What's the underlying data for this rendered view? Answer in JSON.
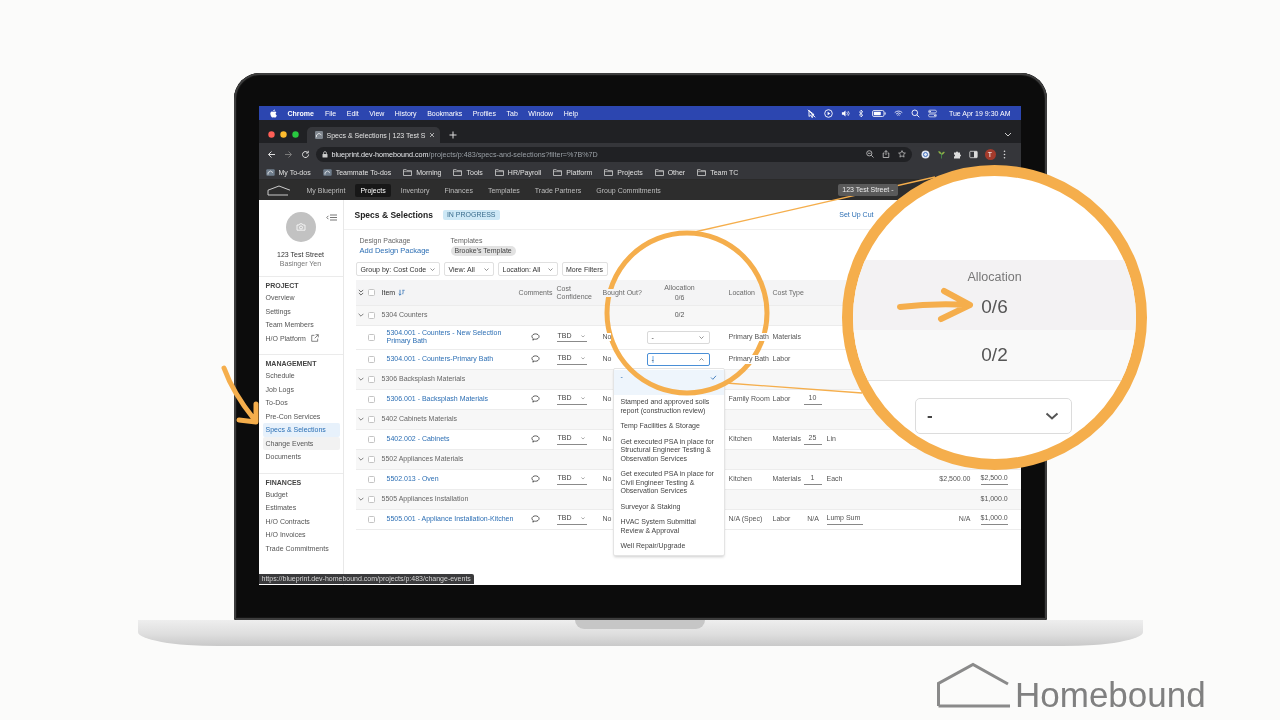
{
  "menu_bar": {
    "app_name": "Chrome",
    "menus": [
      "File",
      "Edit",
      "View",
      "History",
      "Bookmarks",
      "Profiles",
      "Tab",
      "Window",
      "Help"
    ],
    "clock": "Tue Apr 19 9:30 AM"
  },
  "browser": {
    "tab_title": "Specs & Selections | 123 Test S",
    "url_host": "blueprint.dev-homebound.com",
    "url_path": "/projects/p:483/specs-and-selections?filter=%7B%7D",
    "profile_initial": "T",
    "bookmarks": [
      {
        "label": "My To-dos",
        "kind": "page"
      },
      {
        "label": "Teammate To-dos",
        "kind": "page"
      },
      {
        "label": "Morning",
        "kind": "folder"
      },
      {
        "label": "Tools",
        "kind": "folder"
      },
      {
        "label": "HR/Payroll",
        "kind": "folder"
      },
      {
        "label": "Platform",
        "kind": "folder"
      },
      {
        "label": "Projects",
        "kind": "folder"
      },
      {
        "label": "Other",
        "kind": "folder"
      },
      {
        "label": "Team TC",
        "kind": "folder"
      }
    ],
    "status_url": "https://blueprint.dev-homebound.com/projects/p:483/change-events"
  },
  "app_nav": {
    "items": [
      {
        "label": "My Blueprint",
        "selected": false
      },
      {
        "label": "Projects",
        "selected": true
      },
      {
        "label": "Inventory",
        "selected": false
      },
      {
        "label": "Finances",
        "selected": false
      },
      {
        "label": "Templates",
        "selected": false
      },
      {
        "label": "Trade Partners",
        "selected": false
      },
      {
        "label": "Group Commitments",
        "selected": false
      }
    ],
    "project_switcher": "123 Test Street -"
  },
  "sidebar": {
    "project_name": "123 Test Street",
    "project_owner": "Basinger Yen",
    "sections": [
      {
        "title": "PROJECT",
        "items": [
          {
            "label": "Overview",
            "selected": false,
            "hovered": false,
            "external": false
          },
          {
            "label": "Settings",
            "selected": false,
            "hovered": false,
            "external": false
          },
          {
            "label": "Team Members",
            "selected": false,
            "hovered": false,
            "external": false
          },
          {
            "label": "H/O Platform",
            "selected": false,
            "hovered": false,
            "external": true
          }
        ]
      },
      {
        "title": "MANAGEMENT",
        "items": [
          {
            "label": "Schedule",
            "selected": false,
            "hovered": false,
            "external": false
          },
          {
            "label": "Job Logs",
            "selected": false,
            "hovered": false,
            "external": false
          },
          {
            "label": "To-Dos",
            "selected": false,
            "hovered": false,
            "external": false
          },
          {
            "label": "Pre-Con Services",
            "selected": false,
            "hovered": false,
            "external": false
          },
          {
            "label": "Specs & Selections",
            "selected": true,
            "hovered": false,
            "external": false
          },
          {
            "label": "Change Events",
            "selected": false,
            "hovered": true,
            "external": false
          },
          {
            "label": "Documents",
            "selected": false,
            "hovered": false,
            "external": false
          }
        ]
      },
      {
        "title": "FINANCES",
        "items": [
          {
            "label": "Budget",
            "selected": false,
            "hovered": false,
            "external": false
          },
          {
            "label": "Estimates",
            "selected": false,
            "hovered": false,
            "external": false
          },
          {
            "label": "H/O Contracts",
            "selected": false,
            "hovered": false,
            "external": false
          },
          {
            "label": "H/O Invoices",
            "selected": false,
            "hovered": false,
            "external": false
          },
          {
            "label": "Trade Commitments",
            "selected": false,
            "hovered": false,
            "external": false
          }
        ]
      }
    ]
  },
  "page": {
    "title": "Specs & Selections",
    "status": "IN PROGRESS",
    "action_link": "Set Up Cut",
    "design_package_label": "Design Package",
    "design_package_link": "Add Design Package",
    "templates_label": "Templates",
    "template": "Brooke's Template",
    "filters": [
      "Group by: Cost Code",
      "View: All",
      "Location: All"
    ],
    "more_filters": "More Filters"
  },
  "table": {
    "all_checked": false,
    "columns": [
      {
        "label": "Item",
        "sorted": true
      },
      {
        "label": "Comments",
        "sorted": false
      },
      {
        "label": "Cost Confidence",
        "sorted": false
      },
      {
        "label": "Bought Out?",
        "sorted": false
      },
      {
        "label": "Allocation",
        "sorted": false,
        "summary": "0/6"
      },
      {
        "label": "Location",
        "sorted": false
      },
      {
        "label": "Cost Type",
        "sorted": false
      }
    ],
    "groups": [
      {
        "title": "5304 Counters",
        "expanded": true,
        "checked": false,
        "allocation": "0/2",
        "rows": [
          {
            "item": "5304.001 - Counters - New Selection Primary Bath",
            "checked": false,
            "cost_confidence": "TBD",
            "bought_out": "No",
            "allocation": {
              "value": "-",
              "open": false
            },
            "location": "Primary Bath",
            "cost_type": "Materials"
          },
          {
            "item": "5304.001 - Counters-Primary Bath",
            "checked": false,
            "cost_confidence": "TBD",
            "bought_out": "No",
            "allocation": {
              "value": "-",
              "open": true
            },
            "location": "Primary Bath",
            "cost_type": "Labor"
          }
        ]
      },
      {
        "title": "5306 Backsplash Materials",
        "expanded": true,
        "checked": false,
        "rows": [
          {
            "item": "5306.001 - Backsplash Materials",
            "checked": false,
            "cost_confidence": "TBD",
            "bought_out": "No",
            "location": "Family Room",
            "cost_type": "Labor",
            "quantity": {
              "value": "10",
              "editable": true
            }
          }
        ]
      },
      {
        "title": "5402 Cabinets Materials",
        "expanded": true,
        "checked": false,
        "rows": [
          {
            "item": "5402.002 - Cabinets",
            "checked": false,
            "cost_confidence": "TBD",
            "bought_out": "No",
            "location": "Kitchen",
            "cost_type": "Materials",
            "quantity": {
              "value": "25",
              "editable": true
            },
            "unit": {
              "value": "Lin",
              "editable": false
            }
          }
        ]
      },
      {
        "title": "5502 Appliances Materials",
        "expanded": true,
        "checked": false,
        "rows": [
          {
            "item": "5502.013 - Oven",
            "checked": false,
            "cost_confidence": "TBD",
            "bought_out": "No",
            "location": "Kitchen",
            "cost_type": "Materials",
            "quantity": {
              "value": "1",
              "editable": true
            },
            "unit": {
              "value": "Each",
              "editable": false
            },
            "unit_cost": "$2,500.00",
            "total": {
              "value": "$2,500.0",
              "editable": true
            }
          }
        ]
      },
      {
        "title": "5505 Appliances Installation",
        "expanded": true,
        "checked": false,
        "total": "$1,000.0",
        "rows": [
          {
            "item": "5505.001 - Appliance Installation-Kitchen",
            "checked": false,
            "cost_confidence": "TBD",
            "bought_out": "No",
            "location": "N/A (Spec)",
            "cost_type": "Labor",
            "quantity": {
              "value": "N/A",
              "editable": false
            },
            "unit": {
              "value": "Lump Sum",
              "editable": true
            },
            "unit_cost": "N/A",
            "total": {
              "value": "$1,000.0",
              "editable": true
            }
          }
        ]
      }
    ]
  },
  "allocation_menu": {
    "options": [
      {
        "label": "-",
        "selected": true
      },
      {
        "label": "Stamped and approved soils report (construction review)",
        "selected": false
      },
      {
        "label": "Temp Facilities & Storage",
        "selected": false
      },
      {
        "label": "Get executed PSA in place for Structural Engineer Testing & Observation Services",
        "selected": false
      },
      {
        "label": "Get executed PSA in place for Civil Engineer Testing & Observation Services",
        "selected": false
      },
      {
        "label": "Surveyor & Staking",
        "selected": false
      },
      {
        "label": "HVAC System Submittal Review & Approval",
        "selected": false
      },
      {
        "label": "Well Repair/Upgrade",
        "selected": false
      }
    ]
  },
  "magnifier": {
    "column": "Allocation",
    "total": "0/6",
    "group_allocation": "0/2",
    "select_value": "-"
  },
  "brand": {
    "name": "Homebound"
  }
}
